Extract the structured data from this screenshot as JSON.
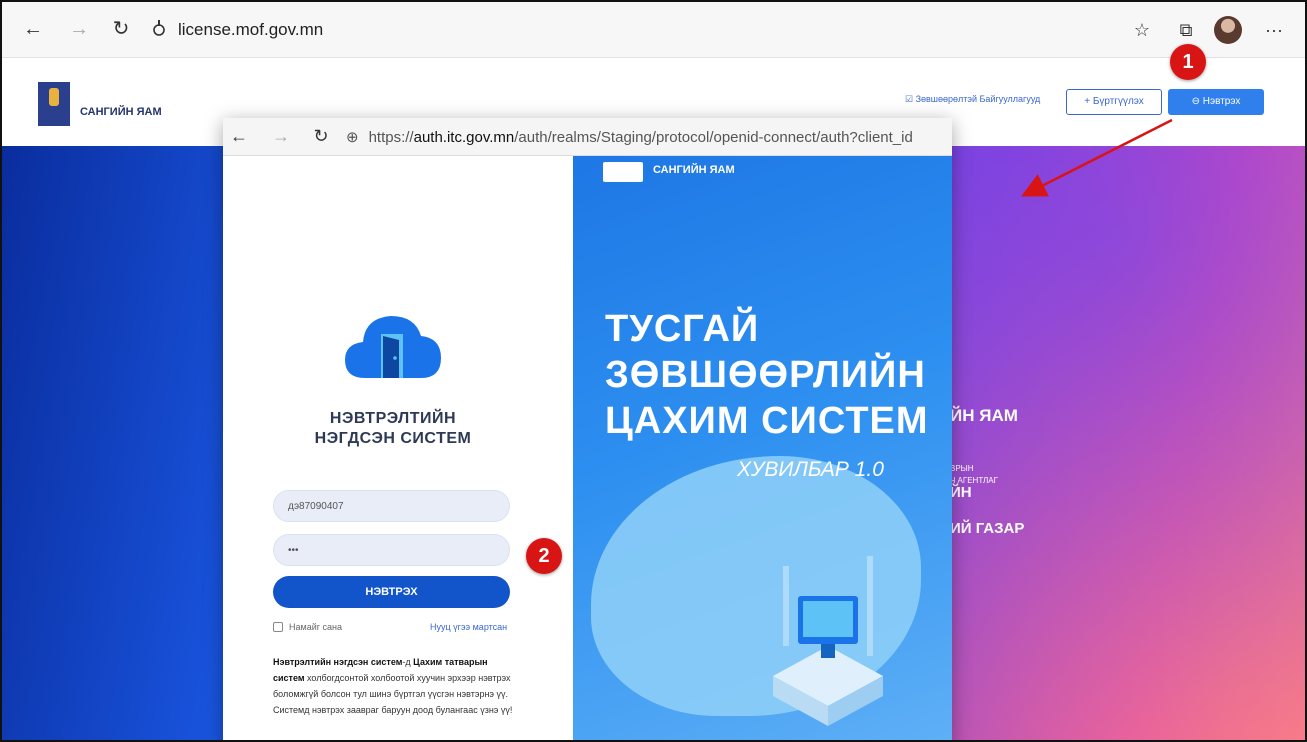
{
  "browser": {
    "url": "license.mof.gov.mn",
    "back_icon": "←",
    "forward_icon": "→",
    "refresh_icon": "↻",
    "favorites_icon": "☆",
    "collections_icon": "⧉",
    "menu_icon": "···"
  },
  "site": {
    "name": "САНГИЙН ЯАМ",
    "approved_orgs": "☑ Зөвшөөрөлтэй Байгууллагууд",
    "register": "+ Бүртгүүлэх",
    "login": "⊖ Нэвтрэх"
  },
  "hero": {
    "ministry": "ЙН ЯАМ",
    "line1": "ВРЫН",
    "line2": "Ч АГЕНТЛАГ",
    "line3": "ЙН",
    "line4": "ИЙ ГАЗАР"
  },
  "popup": {
    "url_prefix": "https://",
    "url_host": "auth.itc.gov.mn",
    "url_path": "/auth/realms/Staging/protocol/openid-connect/auth?client_id",
    "back_icon": "←",
    "forward_icon": "→",
    "refresh_icon": "↻",
    "globe_icon": "⊕",
    "system_title_1": "НЭВТРЭЛТИЙН",
    "system_title_2": "НЭГДСЭН СИСТЕМ",
    "username_value": "дэ87090407",
    "password_value": "•••",
    "submit": "НЭВТРЭХ",
    "remember_me": "Намайг сана",
    "forgot_password": "Нууц үгээ мартсан",
    "info_bold_1": "Нэвтрэлтийн нэгдсэн систем",
    "info_text_1": "-д ",
    "info_bold_2": "Цахим татварын систем",
    "info_text_2": " холбогдсонтой холбоотой хуучин эрхээр нэвтрэх боломжгүй болсон тул шинэ бүртгэл үүсгэн нэвтэрнэ үү. Системд нэвтрэх заавраг баруун доод булангаас үзнэ үү!",
    "right_ministry": "САНГИЙН ЯАМ",
    "title_1": "ТУСГАЙ",
    "title_2": "ЗӨВШӨӨРЛИЙН",
    "title_3": "ЦАХИМ СИСТЕМ",
    "version": "ХУВИЛБАР 1.0"
  },
  "annotations": {
    "badge_1": "1",
    "badge_2": "2",
    "accent": "#d91414"
  }
}
